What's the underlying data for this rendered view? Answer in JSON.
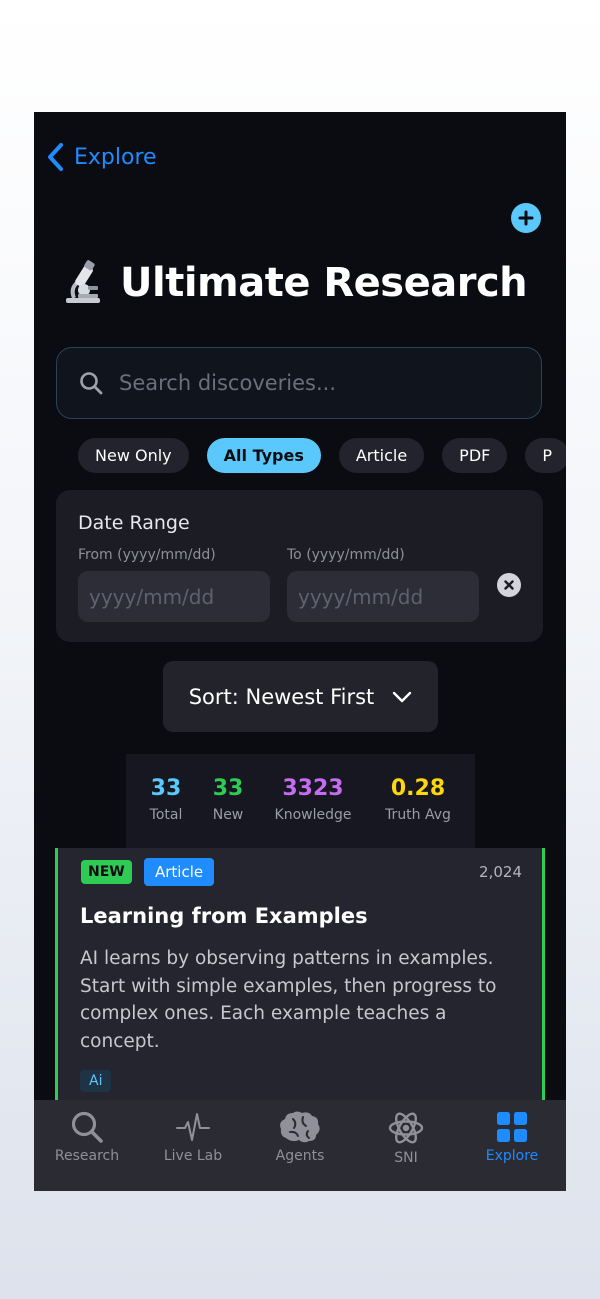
{
  "nav": {
    "back_label": "Explore"
  },
  "header": {
    "title": "Ultimate Research",
    "emoji": "microscope-icon"
  },
  "search": {
    "placeholder": "Search discoveries..."
  },
  "filters": [
    {
      "label": "New Only",
      "active": false
    },
    {
      "label": "All Types",
      "active": true
    },
    {
      "label": "Article",
      "active": false
    },
    {
      "label": "PDF",
      "active": false
    },
    {
      "label": "P",
      "active": false
    }
  ],
  "date_range": {
    "title": "Date Range",
    "from_label": "From (yyyy/mm/dd)",
    "to_label": "To (yyyy/mm/dd)",
    "from_placeholder": "yyyy/mm/dd",
    "to_placeholder": "yyyy/mm/dd"
  },
  "sort": {
    "label": "Sort: Newest First"
  },
  "stats": [
    {
      "value": "33",
      "label": "Total",
      "color": "#5ac8fa"
    },
    {
      "value": "33",
      "label": "New",
      "color": "#2ecc55"
    },
    {
      "value": "3323",
      "label": "Knowledge",
      "color": "#c46cf2"
    },
    {
      "value": "0.28",
      "label": "Truth Avg",
      "color": "#ffd60a"
    }
  ],
  "card": {
    "badge_new": "NEW",
    "badge_type": "Article",
    "number": "2,024",
    "title": "Learning from Examples",
    "description": "AI learns by observing patterns in examples. Start with simple examples, then progress to complex ones. Each example teaches a concept.",
    "tag": "Ai"
  },
  "tabs": [
    {
      "label": "Research",
      "icon": "search-icon",
      "active": false
    },
    {
      "label": "Live Lab",
      "icon": "pulse-icon",
      "active": false
    },
    {
      "label": "Agents",
      "icon": "brain-icon",
      "active": false
    },
    {
      "label": "SNI",
      "icon": "atom-icon",
      "active": false
    },
    {
      "label": "Explore",
      "icon": "grid-icon",
      "active": true
    }
  ],
  "colors": {
    "accent": "#1e8bff",
    "cyan": "#5ac8fa",
    "green": "#2ecc55",
    "background": "#0b0c12"
  }
}
